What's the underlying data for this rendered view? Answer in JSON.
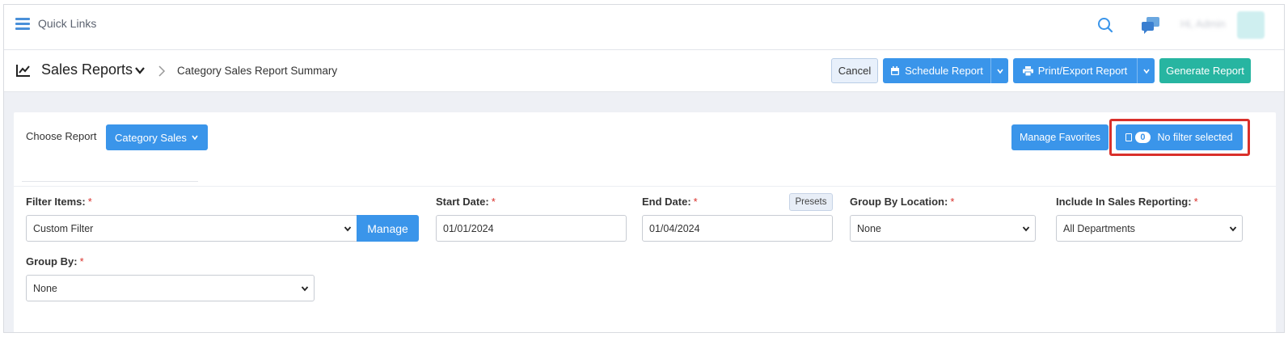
{
  "topbar": {
    "quick_links": "Quick Links",
    "user_name": "Hi, Admin"
  },
  "header": {
    "title": "Sales Reports",
    "breadcrumb": "Category Sales Report Summary",
    "cancel_label": "Cancel",
    "schedule_label": "Schedule Report",
    "print_label": "Print/Export Report",
    "generate_label": "Generate Report"
  },
  "panel": {
    "choose_label": "Choose Report",
    "report_selected": "Category Sales",
    "manage_favorites": "Manage Favorites",
    "filter_count": "0",
    "filter_status": "No filter selected"
  },
  "filters": {
    "filter_items": {
      "label": "Filter Items:",
      "value": "Custom Filter",
      "manage": "Manage"
    },
    "start_date": {
      "label": "Start Date:",
      "value": "01/01/2024"
    },
    "end_date": {
      "label": "End Date:",
      "value": "01/04/2024",
      "presets": "Presets"
    },
    "group_by_location": {
      "label": "Group By Location:",
      "value": "None"
    },
    "include_sales": {
      "label": "Include In Sales Reporting:",
      "value": "All Departments"
    },
    "group_by": {
      "label": "Group By:",
      "value": "None"
    },
    "required_mark": "*"
  },
  "colors": {
    "primary": "#3a95ea",
    "success": "#27b5a1",
    "highlight": "#d9302b"
  }
}
